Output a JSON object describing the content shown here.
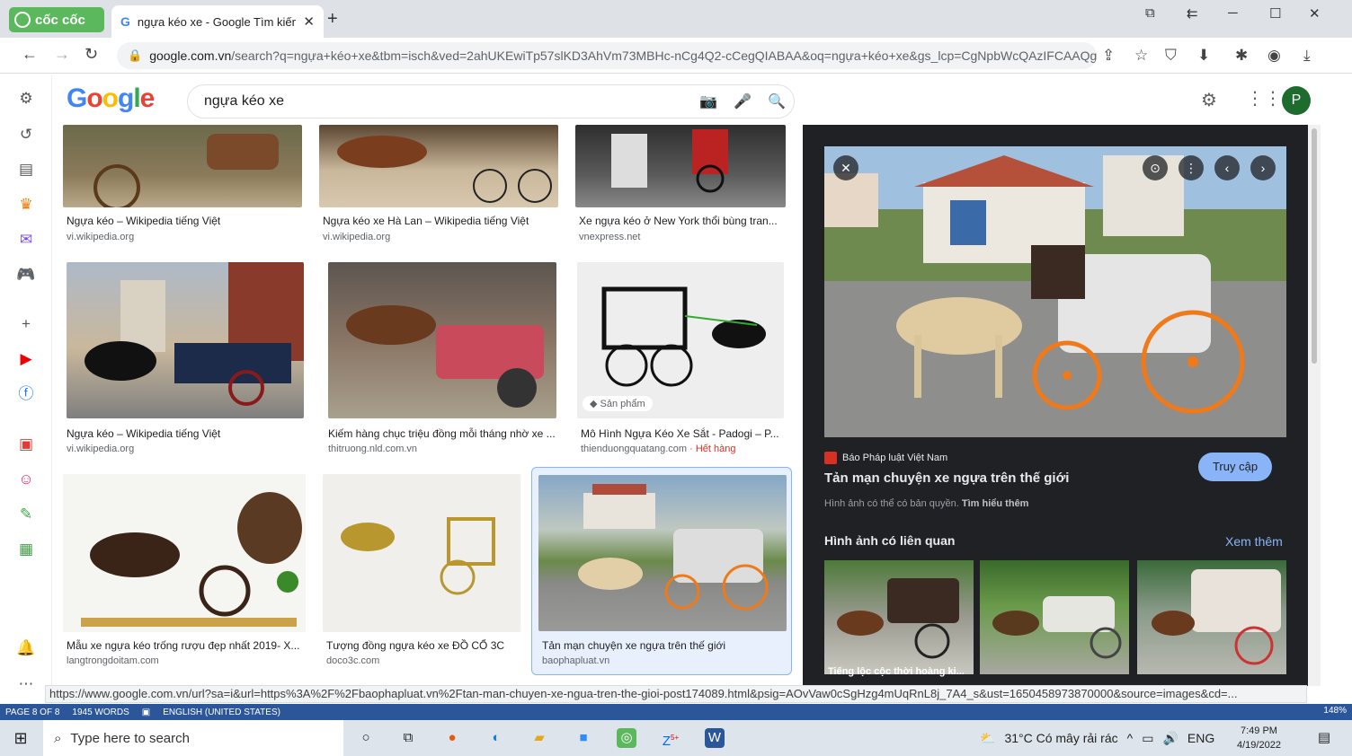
{
  "browser": {
    "brand_label": "cốc cốc",
    "tab_title": "ngựa kéo xe - Google Tìm kiếm",
    "url_host": "google.com.vn",
    "url_rest": "/search?q=ngựa+kéo+xe&tbm=isch&ved=2ahUKEwiTp57slKD3AhVm73MBHc-nCg4Q2-cCegQIABAA&oq=ngựa+kéo+xe&gs_lcp=CgNpbWcQAzIFCAAQgAQ...",
    "status_url": "https://www.google.com.vn/url?sa=i&url=https%3A%2F%2Fbaophapluat.vn%2Ftan-man-chuyen-xe-ngua-tren-the-gioi-post174089.html&psig=AOvVaw0cSgHzg4mUqRnL8j_7A4_s&ust=1650458973870000&source=images&cd=..."
  },
  "google": {
    "logo": "Google",
    "query": "ngựa kéo xe",
    "avatar_letter": "P"
  },
  "results": [
    {
      "caption": "Ngựa kéo – Wikipedia tiếng Việt",
      "source": "vi.wikipedia.org"
    },
    {
      "caption": "Ngựa kéo xe Hà Lan – Wikipedia tiếng Việt",
      "source": "vi.wikipedia.org"
    },
    {
      "caption": "Xe ngựa kéo ở New York thổi bùng tran...",
      "source": "vnexpress.net"
    },
    {
      "caption": "Ngựa kéo – Wikipedia tiếng Việt",
      "source": "vi.wikipedia.org"
    },
    {
      "caption": "Kiếm hàng chục triệu đồng mỗi tháng nhờ xe ...",
      "source": "thitruong.nld.com.vn"
    },
    {
      "caption": "Mô Hình Ngựa Kéo Xe Sắt - Padogi – P...",
      "source": "thienduongquatang.com",
      "source_extra": " · Hết hàng",
      "badge": "Sản phẩm"
    },
    {
      "caption": "Mẫu xe ngựa kéo trống rượu đẹp nhất 2019- X...",
      "source": "langtrongdoitam.com"
    },
    {
      "caption": "Tượng đồng ngựa kéo xe ĐỒ CỔ 3C",
      "source": "doco3c.com"
    },
    {
      "caption": "Tản mạn chuyện xe ngựa trên thế giới",
      "source": "baophapluat.vn"
    }
  ],
  "panel": {
    "source_name": "Báo Pháp luật Việt Nam",
    "title": "Tản mạn chuyện xe ngựa trên thế giới",
    "visit_label": "Truy cập",
    "copyright_text": "Hình ảnh có thể có bản quyền.",
    "learn_more": "Tìm hiểu thêm",
    "related_heading": "Hình ảnh có liên quan",
    "see_more": "Xem thêm",
    "related_caption": "Tiếng lộc cộc thời hoàng ki..."
  },
  "word_status": {
    "page": "PAGE 8 OF 8",
    "words": "1945 WORDS",
    "language": "ENGLISH (UNITED STATES)",
    "zoom": "148%"
  },
  "taskbar": {
    "search_placeholder": "Type here to search",
    "weather": "31°C  Có mây rải rác",
    "lang": "ENG",
    "time": "7:49 PM",
    "date": "4/19/2022",
    "zalo_badge": "5+"
  }
}
